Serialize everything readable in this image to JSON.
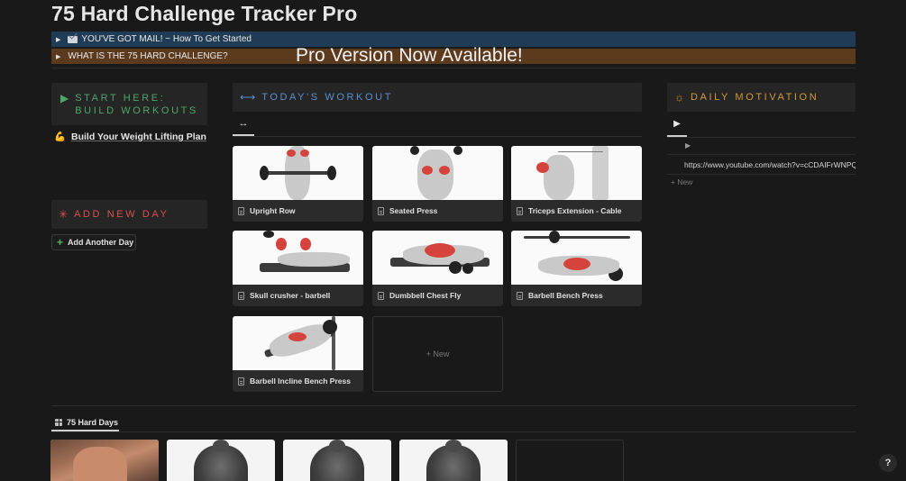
{
  "page": {
    "title": "75 Hard Challenge Tracker  Pro"
  },
  "toggles": [
    {
      "label": "YOU'VE GOT MAIL! ~ How To Get Started",
      "color": "#1f3b55"
    },
    {
      "label": "WHAT IS THE 75 HARD CHALLENGE?",
      "color": "#5c3a1e"
    }
  ],
  "banner": {
    "text": "Pro Version Now Available!"
  },
  "left": {
    "start_callout": {
      "icon": "▶",
      "text": "START HERE: BUILD WORKOUTS",
      "color": "#4ea66a"
    },
    "plan_link": {
      "emoji": "💪",
      "label": "Build Your Weight Lifting Plan"
    },
    "add_callout": {
      "icon": "✳",
      "text": "ADD NEW DAY",
      "color": "#d8504f"
    },
    "add_button": {
      "icon": "+",
      "label": "Add Another Day"
    }
  },
  "workout": {
    "callout": {
      "icon": "⟷",
      "text": "TODAY'S WORKOUT",
      "color": "#5b8fd1"
    },
    "tab_icon": "↔",
    "cards": [
      {
        "name": "Upright Row"
      },
      {
        "name": "Seated Press"
      },
      {
        "name": "Triceps Extension - Cable"
      },
      {
        "name": "Skull crusher - barbell"
      },
      {
        "name": "Dumbbell Chest Fly"
      },
      {
        "name": "Barbell Bench Press"
      },
      {
        "name": "Barbell Incline Bench Press"
      }
    ],
    "new_label": "+ New"
  },
  "motivation": {
    "callout": {
      "icon": "☼",
      "text": "DAILY MOTIVATION",
      "color": "#d39a38"
    },
    "tab_icon": "▶",
    "row_toggle": "▶",
    "url": "https://www.youtube.com/watch?v=cCDAIFrWNPQ",
    "new_label": "+ New"
  },
  "database": {
    "tab_label": "75 Hard Days"
  },
  "help": {
    "label": "?"
  }
}
